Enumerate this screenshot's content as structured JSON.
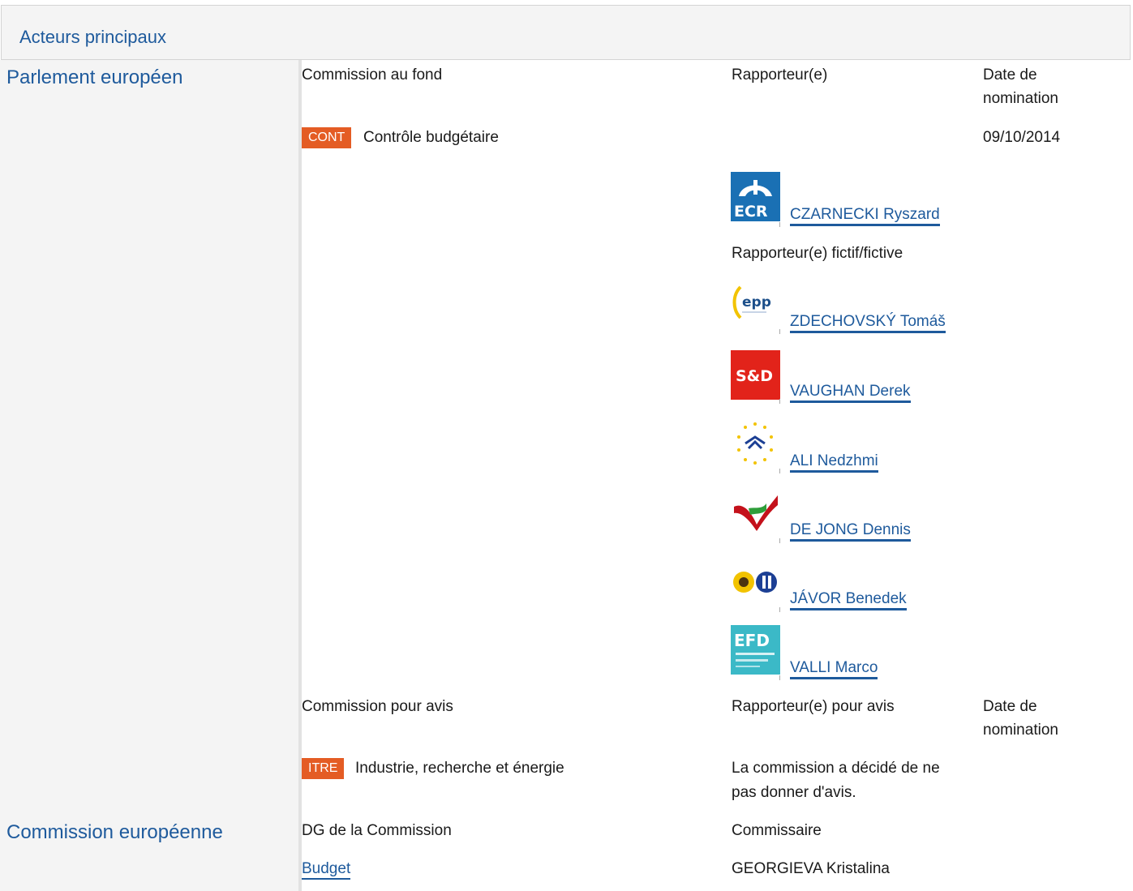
{
  "section": {
    "title": "Acteurs principaux"
  },
  "parliament": {
    "label": "Parlement européen",
    "lead": {
      "col_committee": "Commission au fond",
      "col_rapporteur": "Rapporteur(e)",
      "col_date_1": "Date de",
      "col_date_2": "nomination",
      "committee_code": "CONT",
      "committee_name": "Contrôle budgétaire",
      "date": "09/10/2014",
      "rapporteur": {
        "name": "CZARNECKI Ryszard",
        "group": "ECR"
      },
      "shadow_label": "Rapporteur(e) fictif/fictive",
      "shadows": [
        {
          "name": "ZDECHOVSKÝ Tomáš",
          "group": "epp"
        },
        {
          "name": "VAUGHAN Derek",
          "group": "S&D"
        },
        {
          "name": "ALI Nedzhmi",
          "group": "alde"
        },
        {
          "name": "DE JONG Dennis",
          "group": "gue"
        },
        {
          "name": "JÁVOR Benedek",
          "group": "greens"
        },
        {
          "name": "VALLI Marco",
          "group": "EFD"
        }
      ]
    },
    "opinion": {
      "col_committee": "Commission pour avis",
      "col_rapporteur": "Rapporteur(e) pour avis",
      "col_date_1": "Date de",
      "col_date_2": "nomination",
      "committee_code": "ITRE",
      "committee_name": "Industrie, recherche et énergie",
      "note_1": "La commission a décidé de ne",
      "note_2": "pas donner d'avis."
    }
  },
  "commission": {
    "label": "Commission européenne",
    "col_dg": "DG de la Commission",
    "col_commissioner": "Commissaire",
    "dg": "Budget",
    "commissioner": "GEORGIEVA Kristalina"
  },
  "colors": {
    "accent": "#1e5a9c",
    "badge": "#e45c24",
    "panel": "#f4f4f4"
  }
}
